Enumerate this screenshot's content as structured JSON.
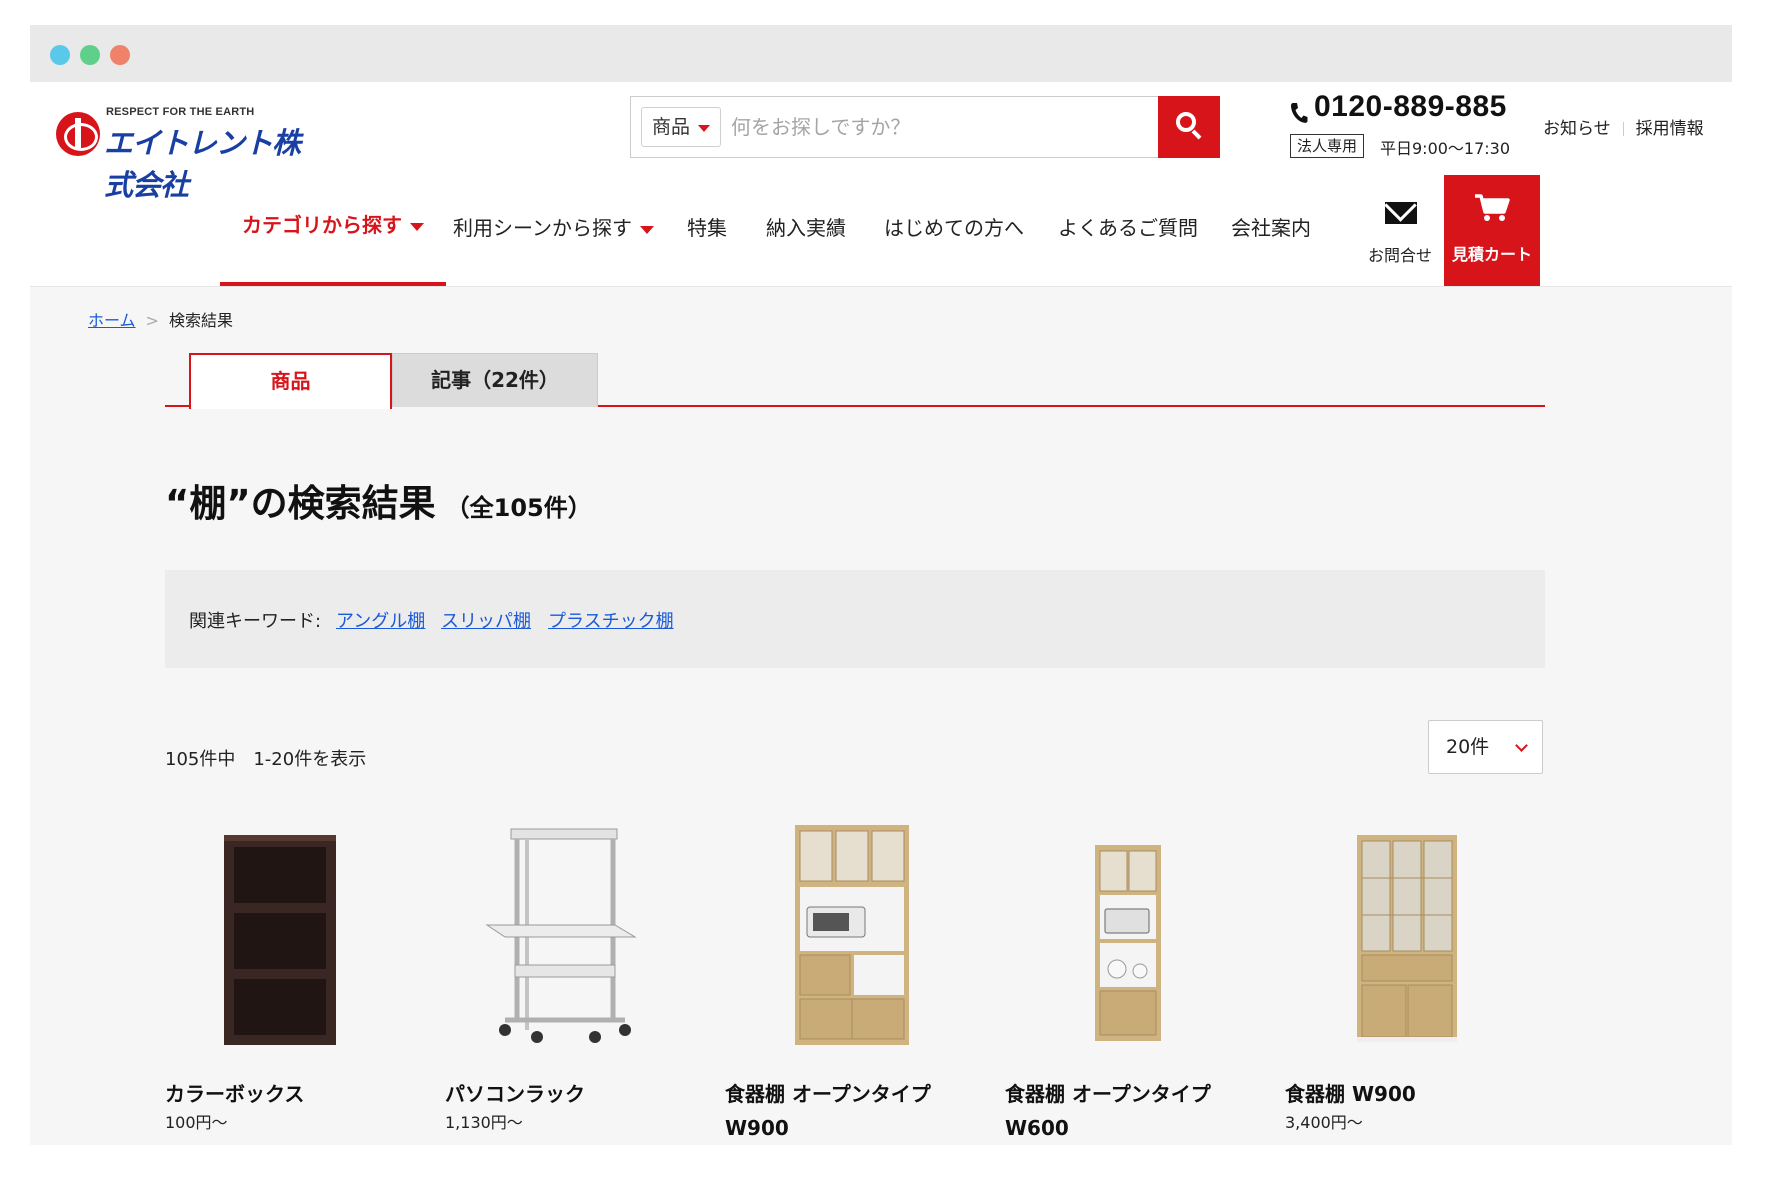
{
  "header": {
    "logo_tagline": "RESPECT FOR THE EARTH",
    "logo_name": "エイトレント株式会社",
    "search": {
      "category": "商品",
      "placeholder": "何をお探しですか？"
    },
    "phone": {
      "number": "0120-889-885",
      "badge": "法人専用",
      "hours": "平日9:00〜17:30"
    },
    "links": [
      "お知らせ",
      "採用情報"
    ],
    "nav": [
      {
        "label": "カテゴリから探す",
        "has_caret": true
      },
      {
        "label": "利用シーンから探す",
        "has_caret": true
      },
      {
        "label": "特集"
      },
      {
        "label": "納入実績"
      },
      {
        "label": "はじめての方へ"
      },
      {
        "label": "よくあるご質問"
      },
      {
        "label": "会社案内"
      }
    ],
    "contact_label": "お問合せ",
    "cart_label": "見積カート"
  },
  "breadcrumb": {
    "home": "ホーム",
    "current": "検索結果"
  },
  "tabs": [
    {
      "label": "商品",
      "active": true
    },
    {
      "label": "記事（22件）",
      "active": false
    }
  ],
  "results": {
    "title": "“棚”の検索結果",
    "count": "（全105件）",
    "showing": "105件中　1-20件を表示",
    "per_page": "20件"
  },
  "keywords": {
    "label": "関連キーワード:",
    "items": [
      "アングル棚",
      "スリッパ棚",
      "プラスチック棚"
    ]
  },
  "products": [
    {
      "name": "カラーボックス",
      "price": "100円〜"
    },
    {
      "name": "パソコンラック",
      "price": "1,130円〜"
    },
    {
      "name": "食器棚 オープンタイプ W900",
      "price": ""
    },
    {
      "name": "食器棚 オープンタイプ W600",
      "price": ""
    },
    {
      "name": "食器棚 W900",
      "price": "3,400円〜"
    }
  ],
  "colors": {
    "brand_red": "#d8141b",
    "link_blue": "#1a5ad8",
    "logo_blue": "#1a3fa3"
  }
}
